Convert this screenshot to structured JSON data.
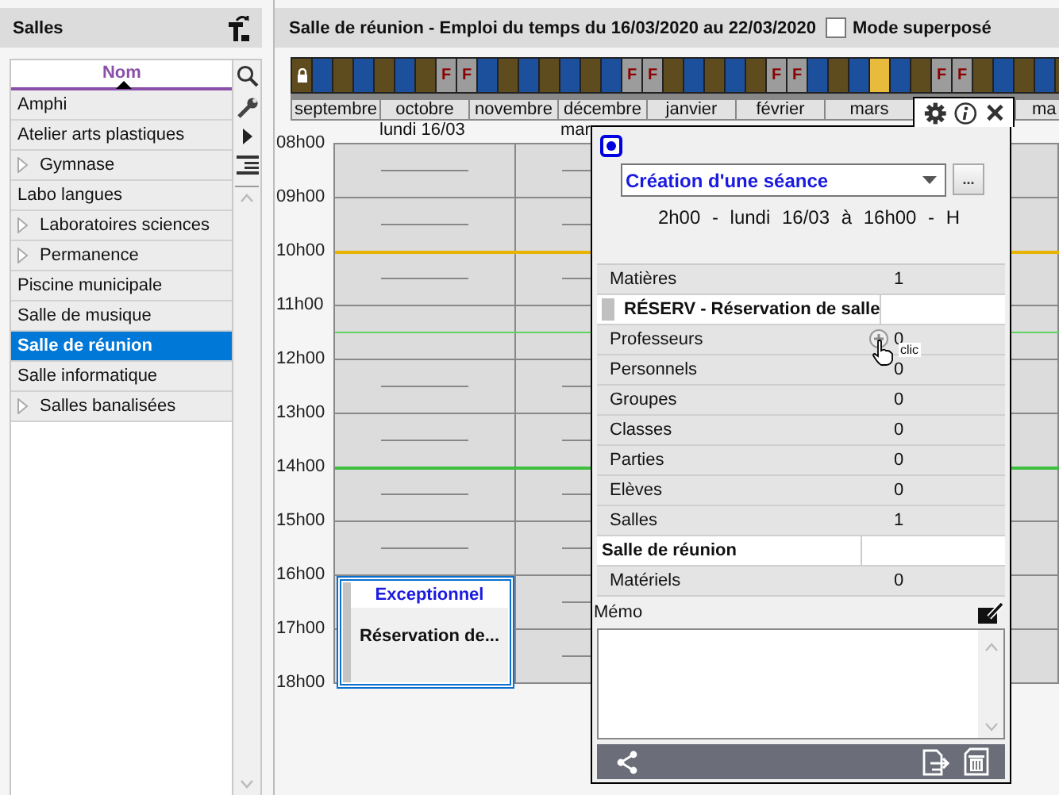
{
  "sidebar": {
    "title": "Salles",
    "column": "Nom",
    "items": [
      {
        "label": "Amphi",
        "expandable": false,
        "selected": false
      },
      {
        "label": "Atelier arts plastiques",
        "expandable": false,
        "selected": false
      },
      {
        "label": "Gymnase",
        "expandable": true,
        "selected": false
      },
      {
        "label": "Labo langues",
        "expandable": false,
        "selected": false
      },
      {
        "label": "Laboratoires sciences",
        "expandable": true,
        "selected": false
      },
      {
        "label": "Permanence",
        "expandable": true,
        "selected": false
      },
      {
        "label": "Piscine municipale",
        "expandable": false,
        "selected": false
      },
      {
        "label": "Salle de musique",
        "expandable": false,
        "selected": false
      },
      {
        "label": "Salle de réunion",
        "expandable": false,
        "selected": true
      },
      {
        "label": "Salle informatique",
        "expandable": false,
        "selected": false
      },
      {
        "label": "Salles banalisées",
        "expandable": true,
        "selected": false
      }
    ]
  },
  "schedule": {
    "title": "Salle de réunion - Emploi du temps du 16/03/2020 au 22/03/2020",
    "overlay_mode": {
      "label": "Mode superposé",
      "checked": false
    },
    "weeks": [
      {
        "kind": "locked"
      },
      {
        "kind": "a"
      },
      {
        "kind": "b"
      },
      {
        "kind": "a"
      },
      {
        "kind": "b"
      },
      {
        "kind": "a"
      },
      {
        "kind": "b"
      },
      {
        "kind": "holiday",
        "label": "F"
      },
      {
        "kind": "holiday",
        "label": "F"
      },
      {
        "kind": "a"
      },
      {
        "kind": "b"
      },
      {
        "kind": "a"
      },
      {
        "kind": "b"
      },
      {
        "kind": "a"
      },
      {
        "kind": "b"
      },
      {
        "kind": "a"
      },
      {
        "kind": "holiday",
        "label": "F"
      },
      {
        "kind": "holiday",
        "label": "F"
      },
      {
        "kind": "b"
      },
      {
        "kind": "a"
      },
      {
        "kind": "b"
      },
      {
        "kind": "a"
      },
      {
        "kind": "b"
      },
      {
        "kind": "holiday",
        "label": "F"
      },
      {
        "kind": "holiday",
        "label": "F"
      },
      {
        "kind": "a"
      },
      {
        "kind": "b"
      },
      {
        "kind": "a"
      },
      {
        "kind": "current"
      },
      {
        "kind": "a"
      },
      {
        "kind": "b"
      },
      {
        "kind": "holiday",
        "label": "F"
      },
      {
        "kind": "holiday",
        "label": "F"
      },
      {
        "kind": "b"
      },
      {
        "kind": "a"
      },
      {
        "kind": "b"
      },
      {
        "kind": "a"
      },
      {
        "kind": "b"
      }
    ],
    "months": [
      "septembre",
      "octobre",
      "novembre",
      "décembre",
      "janvier",
      "février",
      "mars",
      "ma"
    ],
    "hours": [
      "08h00",
      "09h00",
      "10h00",
      "11h00",
      "12h00",
      "13h00",
      "14h00",
      "15h00",
      "16h00",
      "17h00",
      "18h00"
    ],
    "days": [
      {
        "label": "lundi 16/03",
        "events": [
          {
            "title": "Exceptionnel",
            "label": "Réservation de..."
          }
        ]
      },
      {
        "label": "mar"
      }
    ]
  },
  "popup": {
    "dropdown": "Création d'une séance",
    "more_button": "...",
    "summary": "2h00 - lundi 16/03 à 16h00 - H",
    "resources": [
      {
        "kind": "category",
        "label": "Matières",
        "count": "1"
      },
      {
        "kind": "entry",
        "label": "RÉSERV - Réservation de salle",
        "color": "#c0c0c0"
      },
      {
        "kind": "category",
        "label": "Professeurs",
        "count": "0",
        "hint": "clic"
      },
      {
        "kind": "category",
        "label": "Personnels",
        "count": "0"
      },
      {
        "kind": "category",
        "label": "Groupes",
        "count": "0"
      },
      {
        "kind": "category",
        "label": "Classes",
        "count": "0"
      },
      {
        "kind": "category",
        "label": "Parties",
        "count": "0"
      },
      {
        "kind": "category",
        "label": "Elèves",
        "count": "0"
      },
      {
        "kind": "category",
        "label": "Salles",
        "count": "1"
      },
      {
        "kind": "entry",
        "label": "Salle de réunion"
      },
      {
        "kind": "category",
        "label": "Matériels",
        "count": "0"
      }
    ],
    "memo": {
      "label": "Mémo"
    }
  }
}
